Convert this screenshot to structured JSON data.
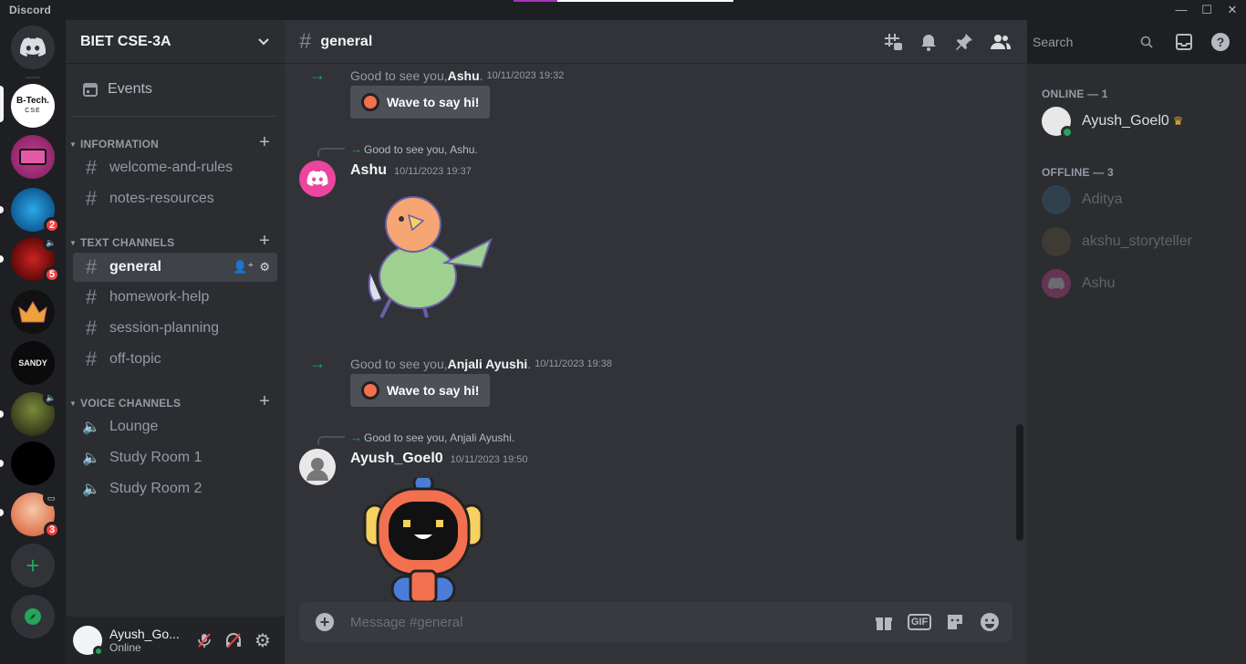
{
  "app": {
    "name": "Discord",
    "update_progress": 0.2
  },
  "servers": [
    {
      "name": "BIET CSE-3A",
      "label": "B-Tech. CSE",
      "active": true
    },
    {
      "name": "cassette-server",
      "badge": ""
    },
    {
      "name": "blue-server",
      "badge": "2"
    },
    {
      "name": "red-server",
      "badge": "5",
      "voice": true
    },
    {
      "name": "crown-server"
    },
    {
      "name": "SANDY",
      "label": "SANDY"
    },
    {
      "name": "zombie-server",
      "voice": true
    },
    {
      "name": "dark-server"
    },
    {
      "name": "girl-server",
      "badge": "3",
      "screen": true
    }
  ],
  "server": {
    "name": "BIET CSE-3A"
  },
  "sidebar": {
    "events_label": "Events",
    "categories": [
      {
        "name": "INFORMATION",
        "channels": [
          "welcome-and-rules",
          "notes-resources"
        ]
      },
      {
        "name": "TEXT CHANNELS",
        "channels": [
          "general",
          "homework-help",
          "session-planning",
          "off-topic"
        ]
      },
      {
        "name": "VOICE CHANNELS",
        "channels": [
          "Lounge",
          "Study Room 1",
          "Study Room 2"
        ]
      }
    ]
  },
  "user": {
    "name": "Ayush_Go...",
    "status": "Online"
  },
  "channel": {
    "name": "general",
    "composer_placeholder": "Message #general"
  },
  "header": {
    "search_placeholder": "Search"
  },
  "messages": {
    "sys1": {
      "text": "Good to see you, ",
      "name": "Ashu",
      "punct": ".",
      "time": "10/11/2023 19:32"
    },
    "wave_label": "Wave to say hi!",
    "reply1": "Good to see you, Ashu.",
    "msg1": {
      "author": "Ashu",
      "time": "10/11/2023 19:37"
    },
    "sys2": {
      "text": "Good to see you, ",
      "name": "Anjali Ayushi",
      "punct": ".",
      "time": "10/11/2023 19:38"
    },
    "reply2": "Good to see you, Anjali Ayushi.",
    "msg2": {
      "author": "Ayush_Goel0",
      "time": "10/11/2023 19:50"
    }
  },
  "members": {
    "online_header": "ONLINE — 1",
    "offline_header": "OFFLINE — 3",
    "online": [
      "Ayush_Goel0"
    ],
    "offline": [
      "Aditya",
      "akshu_storyteller",
      "Ashu"
    ]
  },
  "colors": {
    "accent_green": "#23a55a",
    "brand": "#5865f2",
    "badge_red": "#f23f43",
    "crown": "#f0b232"
  }
}
